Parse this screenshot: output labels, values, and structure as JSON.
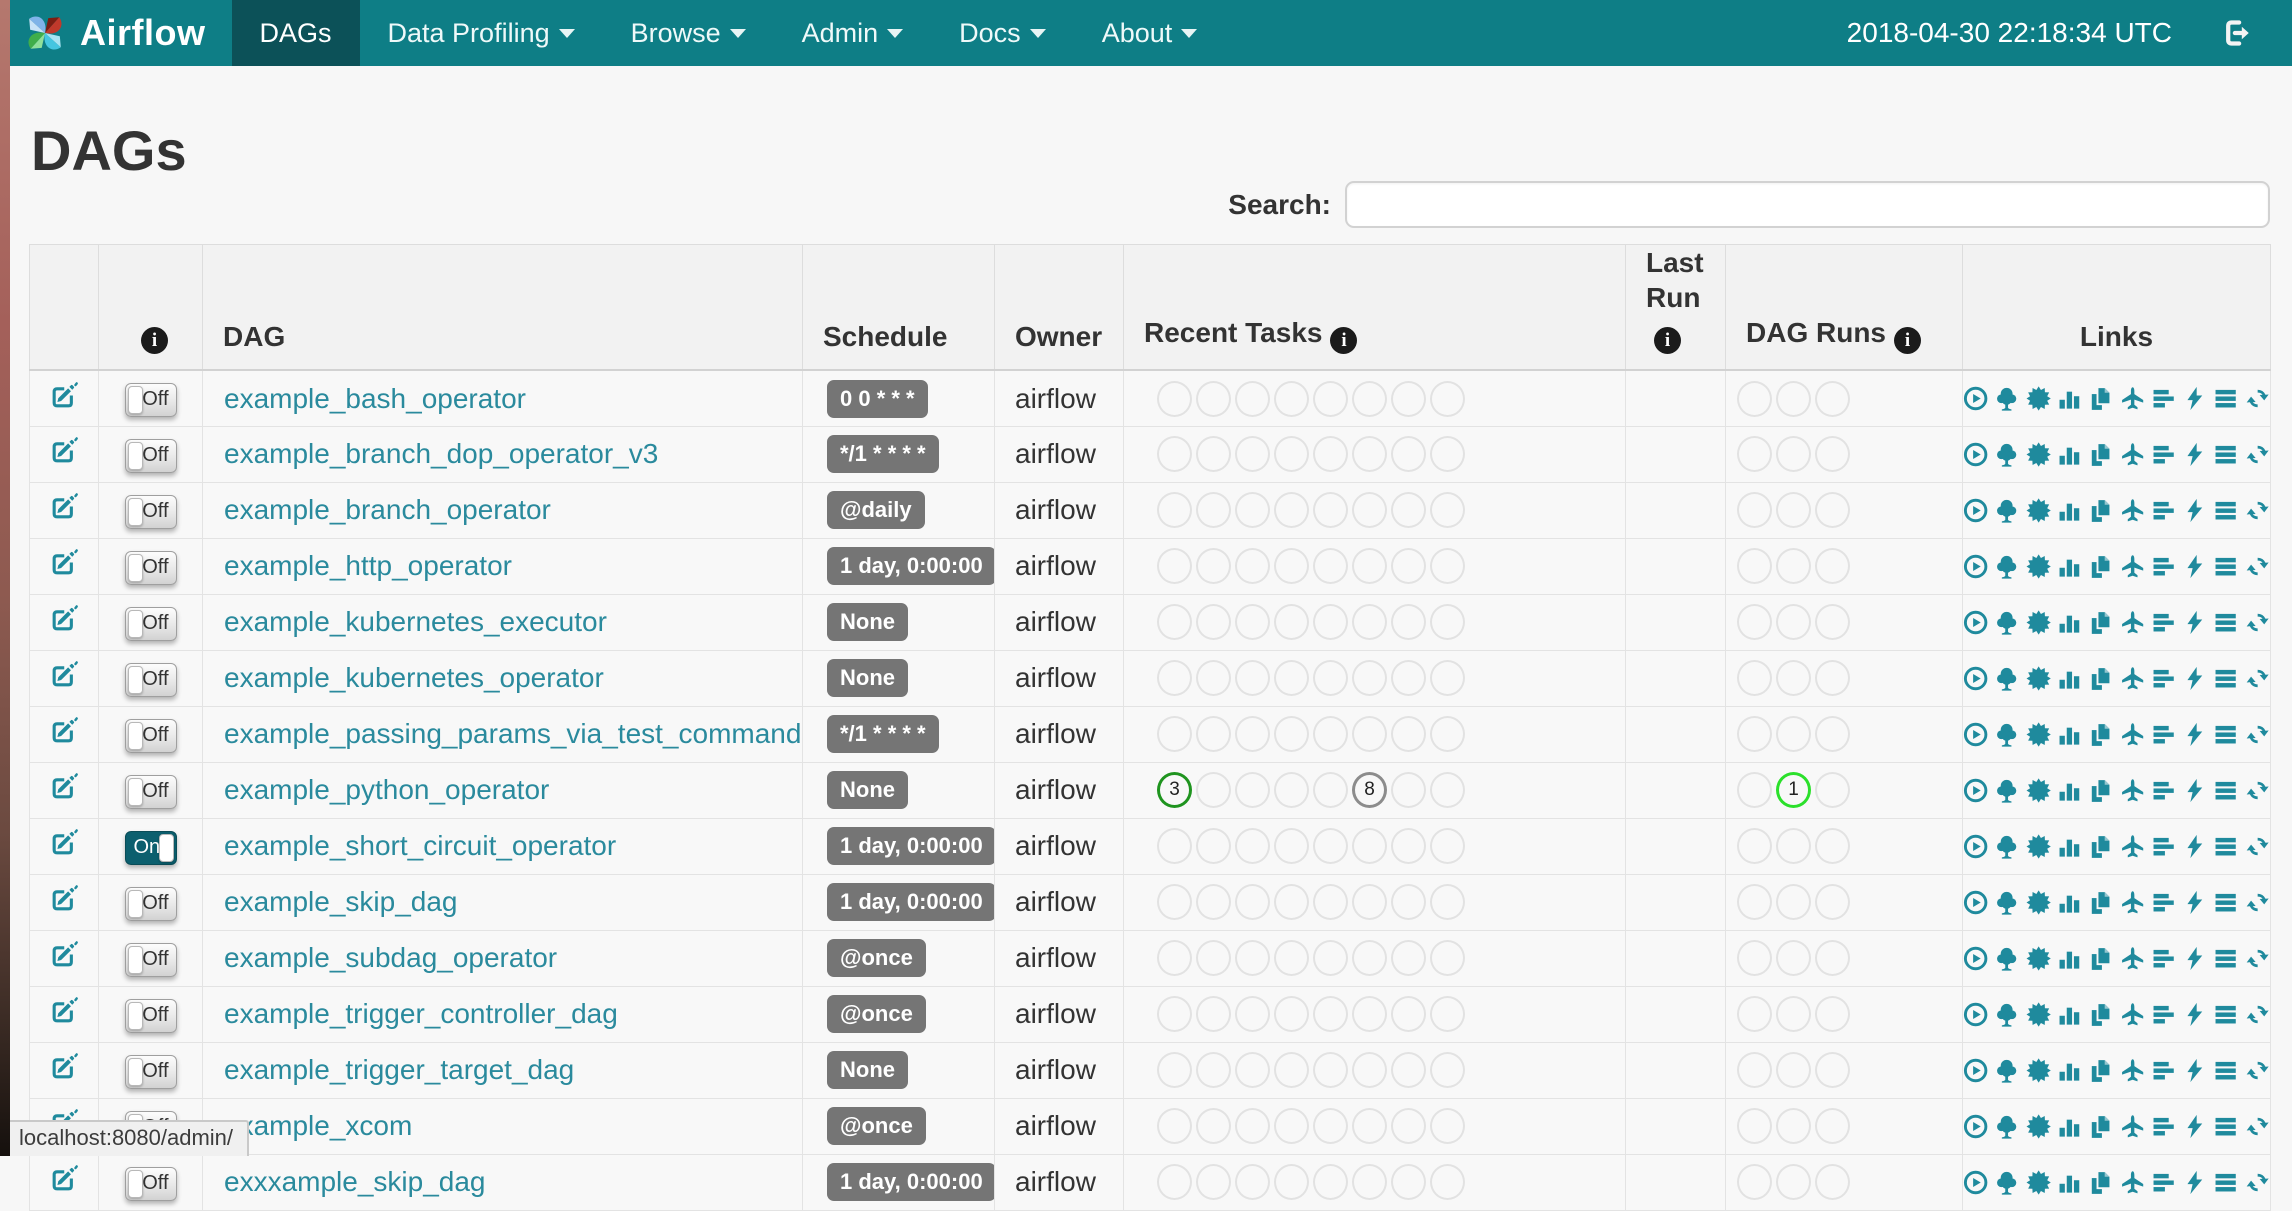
{
  "navbar": {
    "brand": "Airflow",
    "menu": [
      {
        "label": "DAGs",
        "active": true,
        "dropdown": false
      },
      {
        "label": "Data Profiling",
        "active": false,
        "dropdown": true
      },
      {
        "label": "Browse",
        "active": false,
        "dropdown": true
      },
      {
        "label": "Admin",
        "active": false,
        "dropdown": true
      },
      {
        "label": "Docs",
        "active": false,
        "dropdown": true
      },
      {
        "label": "About",
        "active": false,
        "dropdown": true
      }
    ],
    "clock": "2018-04-30 22:18:34 UTC"
  },
  "page": {
    "title": "DAGs",
    "search_label": "Search:",
    "search_value": ""
  },
  "table": {
    "headers": [
      {
        "label": "",
        "info": false,
        "center": false
      },
      {
        "label": "",
        "info": true,
        "center": true
      },
      {
        "label": "DAG",
        "info": false,
        "center": false
      },
      {
        "label": "Schedule",
        "info": false,
        "center": false
      },
      {
        "label": "Owner",
        "info": false,
        "center": false
      },
      {
        "label": "Recent Tasks",
        "info": true,
        "center": false
      },
      {
        "label": "Last Run",
        "info": true,
        "center": false
      },
      {
        "label": "DAG Runs",
        "info": true,
        "center": false
      },
      {
        "label": "Links",
        "info": false,
        "center": true
      }
    ],
    "toggle_on_label": "On",
    "toggle_off_label": "Off",
    "recent_task_slots": 8,
    "dag_run_slots": 3,
    "links": [
      "trigger-dag",
      "tree-view",
      "graph-view",
      "task-duration",
      "task-tries",
      "landing-times",
      "gantt",
      "code-view",
      "logs",
      "refresh"
    ],
    "rows": [
      {
        "dag": "example_bash_operator",
        "schedule": "0 0 * * *",
        "owner": "airflow",
        "enabled": false
      },
      {
        "dag": "example_branch_dop_operator_v3",
        "schedule": "*/1 * * * *",
        "owner": "airflow",
        "enabled": false
      },
      {
        "dag": "example_branch_operator",
        "schedule": "@daily",
        "owner": "airflow",
        "enabled": false
      },
      {
        "dag": "example_http_operator",
        "schedule": "1 day, 0:00:00",
        "owner": "airflow",
        "enabled": false
      },
      {
        "dag": "example_kubernetes_executor",
        "schedule": "None",
        "owner": "airflow",
        "enabled": false
      },
      {
        "dag": "example_kubernetes_operator",
        "schedule": "None",
        "owner": "airflow",
        "enabled": false
      },
      {
        "dag": "example_passing_params_via_test_command",
        "schedule": "*/1 * * * *",
        "owner": "airflow",
        "enabled": false
      },
      {
        "dag": "example_python_operator",
        "schedule": "None",
        "owner": "airflow",
        "enabled": false,
        "recent_tasks": [
          {
            "count": "3",
            "color": "#1f941f"
          },
          null,
          null,
          null,
          null,
          {
            "count": "8",
            "color": "#8c8c8c"
          },
          null,
          null
        ],
        "dag_runs": [
          null,
          {
            "count": "1",
            "color": "#2be02b"
          },
          null
        ]
      },
      {
        "dag": "example_short_circuit_operator",
        "schedule": "1 day, 0:00:00",
        "owner": "airflow",
        "enabled": true
      },
      {
        "dag": "example_skip_dag",
        "schedule": "1 day, 0:00:00",
        "owner": "airflow",
        "enabled": false
      },
      {
        "dag": "example_subdag_operator",
        "schedule": "@once",
        "owner": "airflow",
        "enabled": false
      },
      {
        "dag": "example_trigger_controller_dag",
        "schedule": "@once",
        "owner": "airflow",
        "enabled": false
      },
      {
        "dag": "example_trigger_target_dag",
        "schedule": "None",
        "owner": "airflow",
        "enabled": false
      },
      {
        "dag": "example_xcom",
        "schedule": "@once",
        "owner": "airflow",
        "enabled": false
      },
      {
        "dag": "exxxample_skip_dag",
        "schedule": "1 day, 0:00:00",
        "owner": "airflow",
        "enabled": false
      }
    ]
  },
  "status_bar": {
    "url": "localhost:8080/admin/"
  },
  "colors": {
    "navbar": "#0e7e86",
    "navbar_active": "#0c5158",
    "link_teal": "#2a8a9d",
    "icon_teal": "#1f8a9d",
    "badge_bg": "#757575",
    "task_success": "#1f941f",
    "task_queued": "#8c8c8c",
    "run_running": "#2be02b"
  }
}
